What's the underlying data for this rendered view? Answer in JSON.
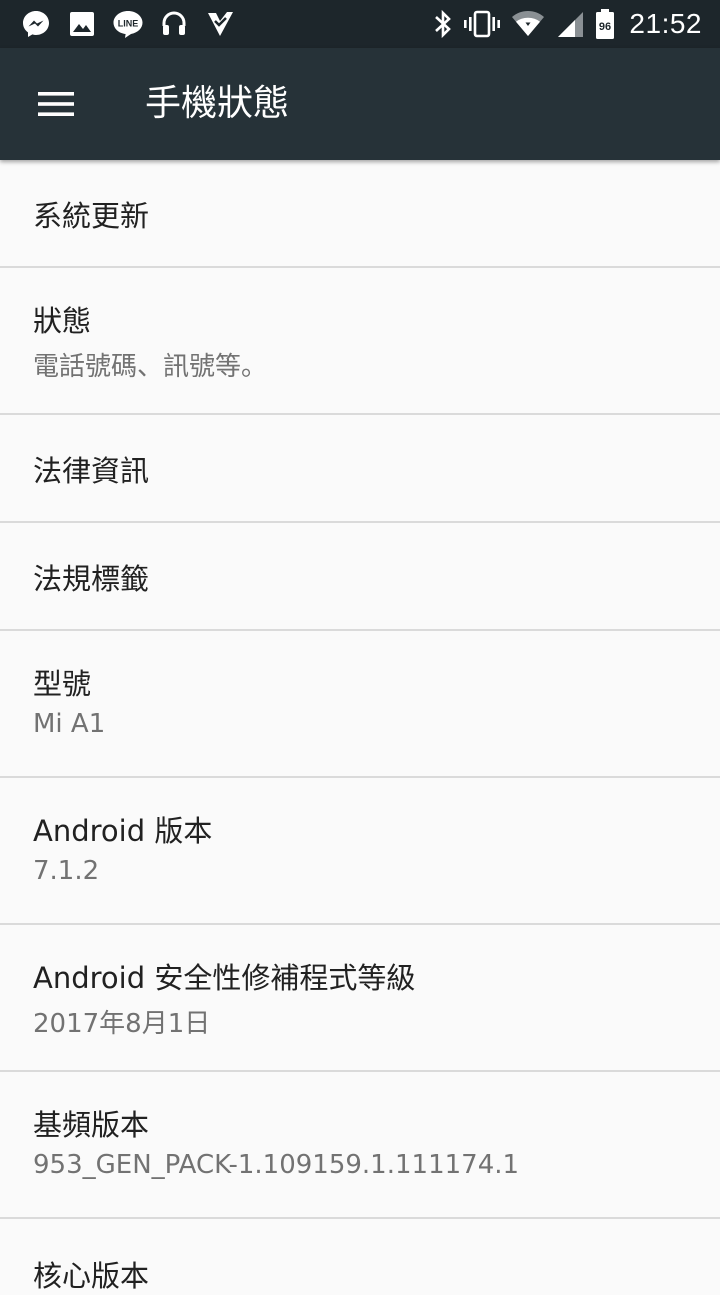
{
  "status_bar": {
    "time": "21:52",
    "battery_level": "96",
    "notification_icons": [
      "messenger-icon",
      "gallery-icon",
      "line-icon",
      "headset-icon",
      "checklist-icon"
    ],
    "system_icons": [
      "bluetooth-icon",
      "vibrate-icon",
      "wifi-icon",
      "cell-signal-icon",
      "battery-icon"
    ]
  },
  "toolbar": {
    "title": "手機狀態"
  },
  "settings": {
    "items": [
      {
        "title": "系統更新"
      },
      {
        "title": "狀態",
        "summary": "電話號碼、訊號等。"
      },
      {
        "title": "法律資訊"
      },
      {
        "title": "法規標籤"
      },
      {
        "title": "型號",
        "summary": "Mi A1"
      },
      {
        "title": "Android 版本",
        "summary": "7.1.2"
      },
      {
        "title": "Android 安全性修補程式等級",
        "summary": "2017年8月1日"
      },
      {
        "title": "基頻版本",
        "summary": "953_GEN_PACK-1.109159.1.111174.1"
      },
      {
        "title": "核心版本"
      }
    ]
  },
  "colors": {
    "status_bar_bg": "#1d262b",
    "toolbar_bg": "#263238",
    "list_bg": "#fafafa",
    "divider": "#dadada",
    "title_text": "#212121",
    "summary_text": "#727272"
  }
}
